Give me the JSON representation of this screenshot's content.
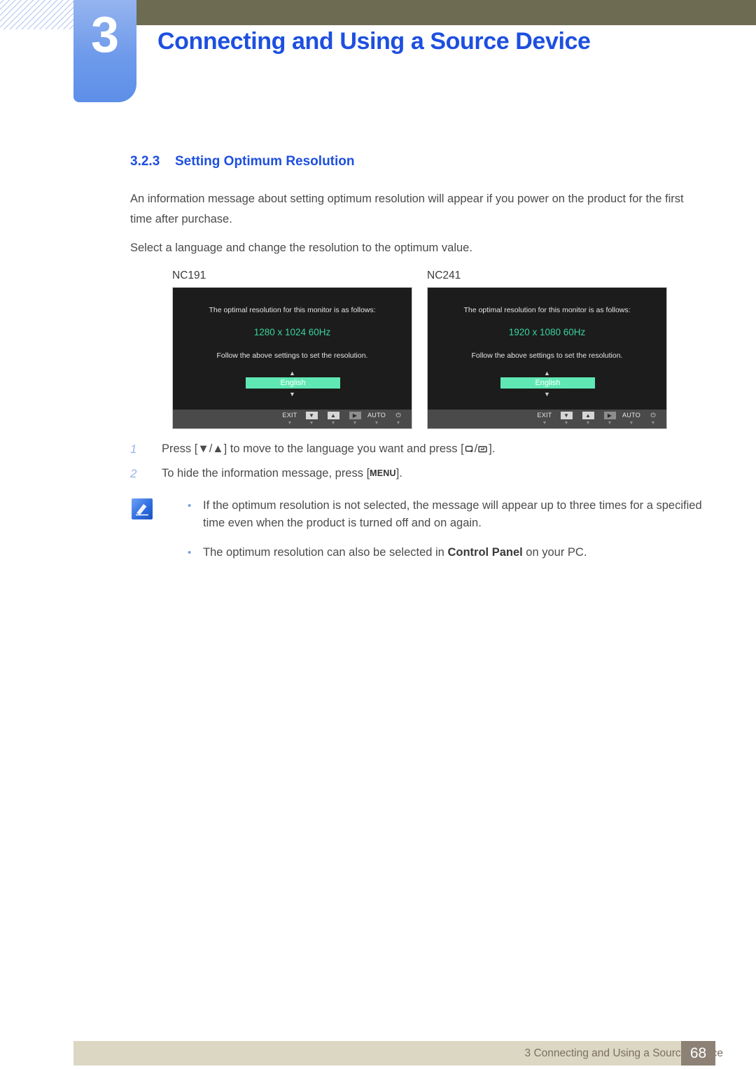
{
  "header": {
    "chapter_number": "3",
    "chapter_title": "Connecting and Using a Source Device"
  },
  "section": {
    "number": "3.2.3",
    "title": "Setting Optimum Resolution",
    "paragraph1": "An information message about setting optimum resolution will appear if you power on the product for the first time after purchase.",
    "paragraph2": "Select a language and change the resolution to the optimum value."
  },
  "figures": [
    {
      "label": "NC191",
      "osd": {
        "line1": "The optimal resolution for this monitor is as follows:",
        "resolution": "1280 x 1024  60Hz",
        "line2": "Follow the above settings to set the resolution.",
        "arrow_up": "▲",
        "arrow_down": "▼",
        "language": "English",
        "buttons": [
          {
            "label": "EXIT",
            "kind": "text"
          },
          {
            "label": "▼",
            "kind": "box"
          },
          {
            "label": "▲",
            "kind": "box"
          },
          {
            "label": "▶",
            "kind": "box-dim"
          },
          {
            "label": "AUTO",
            "kind": "text"
          },
          {
            "label": "⏻",
            "kind": "text"
          }
        ]
      }
    },
    {
      "label": "NC241",
      "osd": {
        "line1": "The optimal resolution for this monitor is as follows:",
        "resolution": "1920 x 1080  60Hz",
        "line2": "Follow the above settings to set the resolution.",
        "arrow_up": "▲",
        "arrow_down": "▼",
        "language": "English",
        "buttons": [
          {
            "label": "EXIT",
            "kind": "text"
          },
          {
            "label": "▼",
            "kind": "box"
          },
          {
            "label": "▲",
            "kind": "box"
          },
          {
            "label": "▶",
            "kind": "box-dim"
          },
          {
            "label": "AUTO",
            "kind": "text"
          },
          {
            "label": "⏻",
            "kind": "text"
          }
        ]
      }
    }
  ],
  "steps": [
    {
      "number": "1",
      "text_before": "Press [",
      "keys": "▼/▲",
      "text_middle": "] to move to the language you want and press [",
      "text_after": "].",
      "full": "Press [▼/▲] to move to the language you want and press [SOURCE/ENTER]."
    },
    {
      "number": "2",
      "text_before": "To hide the information message, press [",
      "key": "MENU",
      "text_after": "].",
      "full": "To hide the information message, press [MENU]."
    }
  ],
  "notes": [
    {
      "text": "If the optimum resolution is not selected, the message will appear up to three times for a specified time even when the product is turned off and on again.",
      "bullet": "•"
    },
    {
      "text_before": "The optimum resolution can also be selected in ",
      "bold": "Control Panel",
      "text_after": " on your PC.",
      "bullet": "•"
    }
  ],
  "footer": {
    "text": "3 Connecting and Using a Source Device",
    "page_number": "68"
  },
  "colors": {
    "accent_blue": "#1d4fe0",
    "tab_blue": "#6e9aeb",
    "olive": "#6e6b53",
    "osd_bg": "#1c1c1c",
    "osd_green": "#3ad29c",
    "highlight_green": "#5fe8b4",
    "footer_bar": "#dcd7c3",
    "footer_page": "#8d8175"
  }
}
